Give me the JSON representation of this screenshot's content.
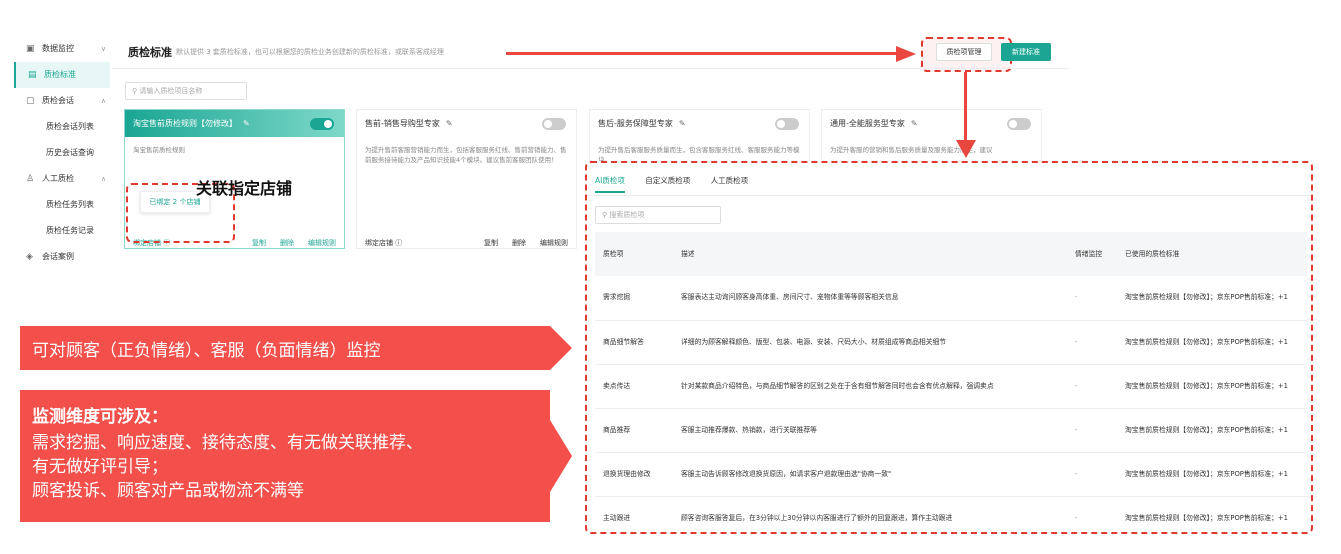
{
  "sidebar": {
    "items": [
      {
        "icon": "monitor-icon",
        "label": "数据监控"
      },
      {
        "icon": "document-icon",
        "label": "质检标准"
      },
      {
        "icon": "chat-icon",
        "label": "质检会话"
      },
      {
        "label": "质检会话列表"
      },
      {
        "label": "历史会话查询"
      },
      {
        "icon": "user-icon",
        "label": "人工质检"
      },
      {
        "label": "质检任务列表"
      },
      {
        "label": "质检任务记录"
      },
      {
        "icon": "layers-icon",
        "label": "会话案例"
      }
    ]
  },
  "header": {
    "title": "质检标准",
    "subtitle": "默认提供 3 套质检标准，也可以根据您的质检业务创建新的质检标准，或联系客成经理",
    "qc_manage_button": "质检项管理",
    "new_standard_button": "新建标准"
  },
  "search": {
    "placeholder": "请输入质检项目名称"
  },
  "cards": [
    {
      "title": "淘宝售前质检规则【勿修改】",
      "desc": "淘宝售前质检规则",
      "toggle_on": true,
      "bind_label": "绑定店铺",
      "actions": [
        "复制",
        "删除",
        "编辑规则"
      ]
    },
    {
      "title": "售前-销售导购型专家",
      "desc": "为提升售前客服营销能力而生，包括客服服务红线、售前营销能力、售前服务接待能力及产品知识技能4个模块。建议售前客服团队使用！",
      "toggle_on": false,
      "bind_label": "绑定店铺",
      "actions": [
        "复制",
        "删除",
        "编辑规则"
      ]
    },
    {
      "title": "售后-服务保障型专家",
      "desc": "为提升售后客服服务质量而生，包含客服服务红线、客服服务能力等模块。",
      "toggle_on": false,
      "bind_label": "",
      "actions": []
    },
    {
      "title": "通用-全能服务型专家",
      "desc": "为提升客服的营销和售后服务质量及服务能力而生，建议",
      "toggle_on": false,
      "bind_label": "",
      "actions": []
    }
  ],
  "tooltip": {
    "text": "已绑定 2 个店铺"
  },
  "annotation_shop": "关联指定店铺",
  "panel": {
    "tabs": [
      "AI质检项",
      "自定义质检项",
      "人工质检项"
    ],
    "search_placeholder": "搜索质检项",
    "columns": [
      "质检项",
      "描述",
      "情绪监控",
      "已使用的质检标准"
    ],
    "rows": [
      {
        "item": "需求挖掘",
        "desc": "客服表达主动询问顾客身高体重、房间尺寸、宠物体重等等顾客相关信息",
        "emotion": "-",
        "used": "淘宝售前质检规则【勿修改】；京东POP售前标准；+1"
      },
      {
        "item": "商品细节解答",
        "desc": "详细的为顾客解释颜色、版型、包装、电源、安装、尺码大小、材质组成等商品相关细节",
        "emotion": "-",
        "used": "淘宝售前质检规则【勿修改】；京东POP售前标准；+1"
      },
      {
        "item": "卖点传达",
        "desc": "针对某款商品介绍特色，与商品细节解答的区别之处在于含有细节解答同时也会含有优点解释，强调卖点",
        "emotion": "-",
        "used": "淘宝售前质检规则【勿修改】；京东POP售前标准；+1"
      },
      {
        "item": "商品推荐",
        "desc": "客服主动推荐爆款、热销款，进行关联推荐等",
        "emotion": "-",
        "used": "淘宝售前质检规则【勿修改】；京东POP售前标准；+1"
      },
      {
        "item": "退换货理由修改",
        "desc": "客服主动告诉顾客修改退换货原因，如请求客户退款理由选\"协商一致\"",
        "emotion": "-",
        "used": "淘宝售前质检规则【勿修改】；京东POP售前标准；+1"
      },
      {
        "item": "主动跟进",
        "desc": "顾客咨询客服答复后，在3分钟以上30分钟以内客服进行了额外的回复跟进，算作主动跟进",
        "emotion": "-",
        "used": "淘宝售前质检规则【勿修改】；京东POP售前标准；+1"
      }
    ]
  },
  "banner1": {
    "text": "可对顾客（正负情绪）、客服（负面情绪）监控"
  },
  "banner2": {
    "heading": "监测维度可涉及：",
    "lines": [
      "需求挖掘、响应速度、接待态度、有无做关联推荐、",
      "有无做好评引导；",
      "顾客投诉、顾客对产品或物流不满等"
    ]
  },
  "colors": {
    "accent": "#1aa693",
    "annotation_red": "#f3504b",
    "dash_red": "#e0392f"
  }
}
